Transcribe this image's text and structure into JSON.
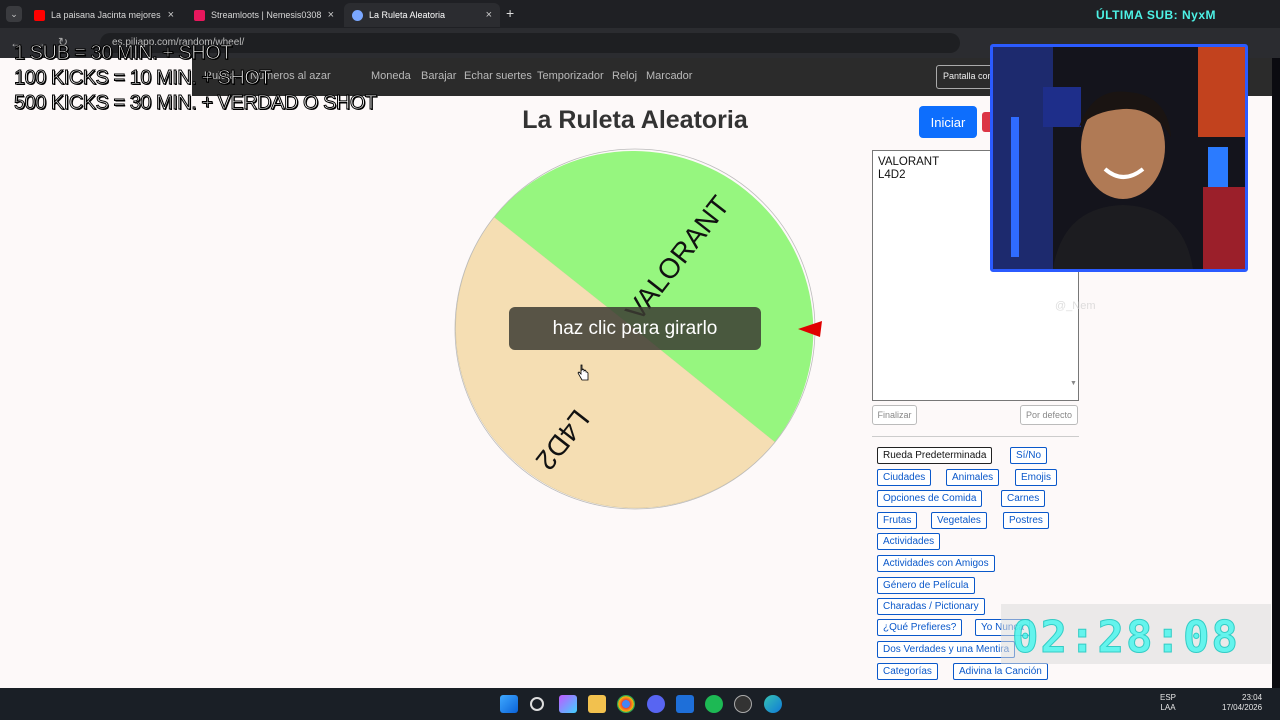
{
  "browser": {
    "tabs": [
      {
        "title": "La paisana Jacinta mejores mor",
        "color": "#ff0000",
        "active": false
      },
      {
        "title": "Streamloots | Nemesis0308 | Ap",
        "color": "#e8175d",
        "active": false
      },
      {
        "title": "La Ruleta Aleatoria",
        "color": "#7aa7ff",
        "active": true
      }
    ],
    "close_glyph": "×",
    "new_tab_glyph": "+",
    "url": "es.piliapp.com/random/wheel/"
  },
  "nav": {
    "items": [
      "Ruleta",
      "Números al azar",
      "Moneda",
      "Barajar",
      "Echar suertes",
      "Temporizador",
      "Reloj",
      "Marcador"
    ],
    "fullscreen_label": "Pantalla completa"
  },
  "wheel": {
    "title": "La Ruleta Aleatoria",
    "start_label": "Iniciar",
    "spin_hint": "haz clic para girarlo",
    "segments": [
      {
        "label": "VALORANT",
        "color": "#96f67f"
      },
      {
        "label": "L4D2",
        "color": "#f5deb3"
      }
    ],
    "pointer_color": "#e00000"
  },
  "editor": {
    "entries": [
      "VALORANT",
      "L4D2"
    ],
    "finish_label": "Finalizar",
    "default_label": "Por defecto"
  },
  "presets": [
    "Rueda Predeterminada",
    "Sí/No",
    "Ciudades",
    "Animales",
    "Emojis",
    "Opciones de Comida",
    "Carnes",
    "Frutas",
    "Vegetales",
    "Postres",
    "Actividades",
    "Actividades con Amigos",
    "Género de Película",
    "Charadas / Pictionary",
    "¿Qué Prefieres?",
    "Yo Nunca",
    "Dos Verdades y una Mentira",
    "Categorías",
    "Adivina la Canción"
  ],
  "stream": {
    "alerts": [
      "1 SUB = 30 MIN. + SHOT",
      "100 KICKS = 10 MIN. + SHOT",
      "500 KICKS = 30 MIN. + VERDAD O SHOT"
    ],
    "last_sub": "ÚLTIMA SUB: NyxM",
    "timer": "02:28:08",
    "ghost_text": "@_Nem"
  },
  "taskbar": {
    "lang": "ESP",
    "layout": "LAA",
    "time": "23:04",
    "date": "17/04/2026"
  }
}
